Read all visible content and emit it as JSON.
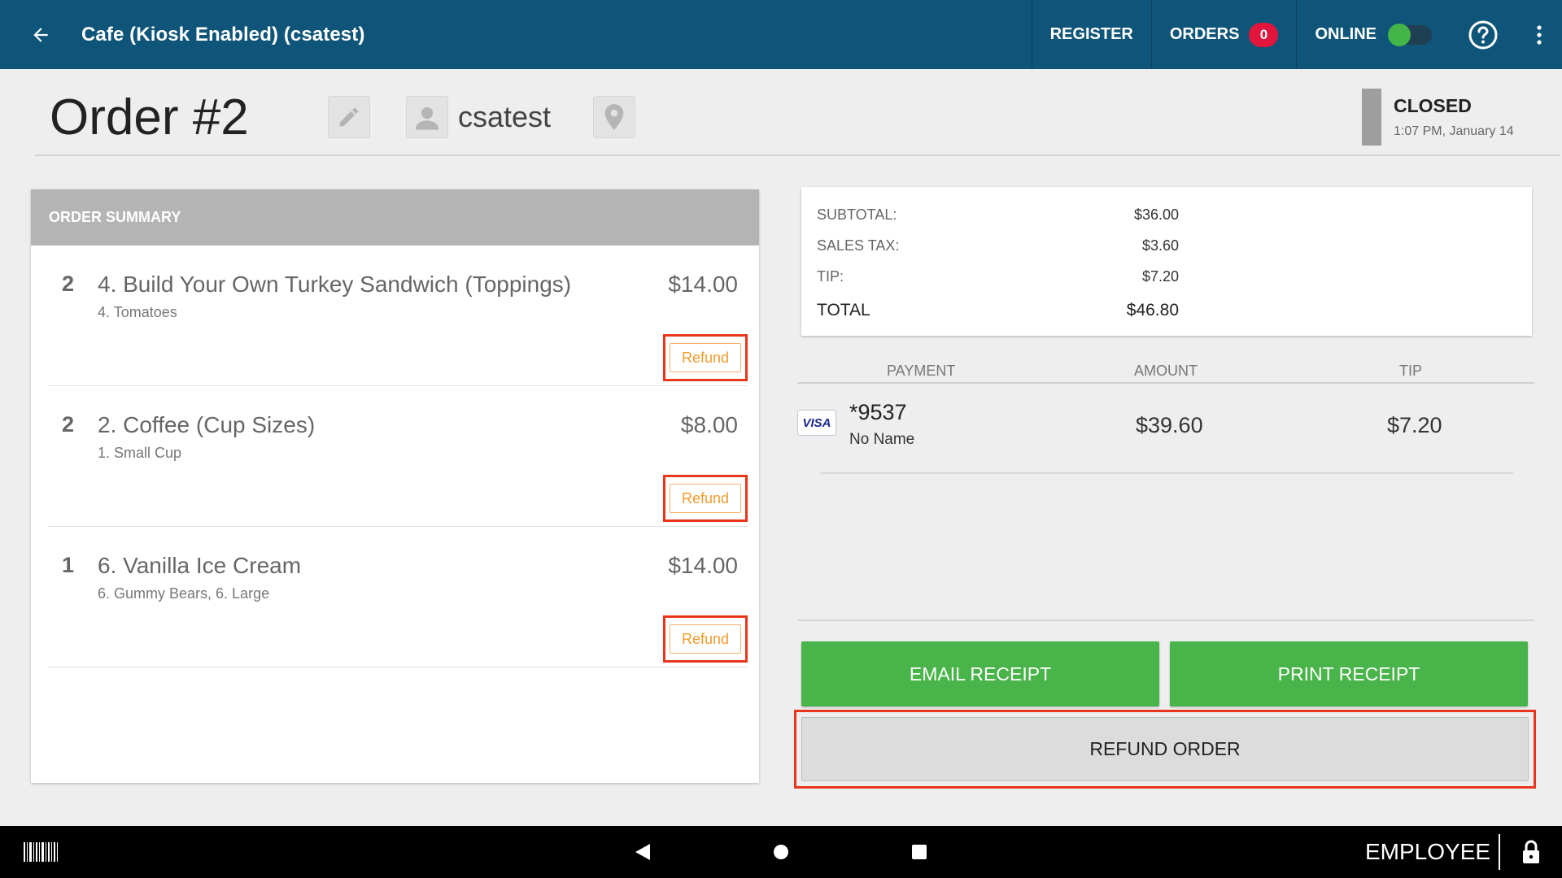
{
  "topbar": {
    "title": "Cafe (Kiosk Enabled) (csatest)",
    "register_label": "REGISTER",
    "orders_label": "ORDERS",
    "orders_count": "0",
    "online_label": "ONLINE",
    "online_enabled": true,
    "background_color": "#0f5579"
  },
  "order": {
    "title": "Order #2",
    "customer": "csatest",
    "status": "CLOSED",
    "status_time": "1:07 PM, January 14"
  },
  "summary": {
    "header": "ORDER SUMMARY",
    "refund_label": "Refund",
    "items": [
      {
        "qty": "2",
        "name": "4. Build Your Own Turkey Sandwich (Toppings)",
        "modifiers": "4. Tomatoes",
        "price": "$14.00"
      },
      {
        "qty": "2",
        "name": "2. Coffee (Cup Sizes)",
        "modifiers": "1. Small Cup",
        "price": "$8.00"
      },
      {
        "qty": "1",
        "name": "6. Vanilla Ice Cream",
        "modifiers": "6. Gummy Bears, 6. Large",
        "price": "$14.00"
      }
    ]
  },
  "totals": {
    "subtotal_label": "SUBTOTAL:",
    "subtotal": "$36.00",
    "tax_label": "SALES TAX:",
    "tax": "$3.60",
    "tip_label": "TIP:",
    "tip": "$7.20",
    "total_label": "TOTAL",
    "total": "$46.80"
  },
  "payments": {
    "col_payment": "PAYMENT",
    "col_amount": "AMOUNT",
    "col_tip": "TIP",
    "rows": [
      {
        "card_brand": "VISA",
        "card_number": "*9537",
        "card_name": "No Name",
        "amount": "$39.60",
        "tip": "$7.20"
      }
    ]
  },
  "actions": {
    "email_receipt": "EMAIL RECEIPT",
    "print_receipt": "PRINT RECEIPT",
    "refund_order": "REFUND ORDER",
    "green_color": "#49b449",
    "highlight_color": "#e8361d"
  },
  "bottombar": {
    "employee_label": "EMPLOYEE"
  }
}
